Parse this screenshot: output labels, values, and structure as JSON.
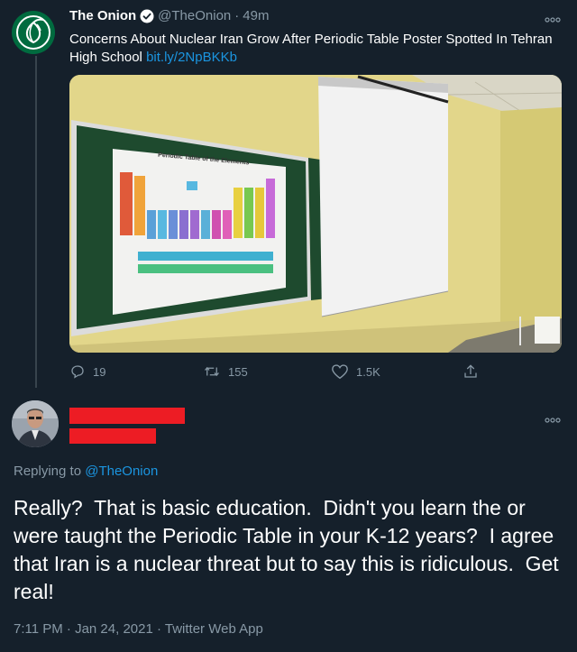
{
  "tweet": {
    "author_name": "The Onion",
    "verified": true,
    "handle": "@TheOnion",
    "separator": "·",
    "time": "49m",
    "text": "Concerns About Nuclear Iran Grow After Periodic Table Poster Spotted In Tehran High School",
    "link": "bit.ly/2NpBKKb",
    "media": {
      "poster_title": "Periodic Table of the Elements"
    },
    "actions": {
      "replies": "19",
      "retweets": "155",
      "likes": "1.5K"
    }
  },
  "reply": {
    "replying_prefix": "Replying to",
    "replying_handle": "@TheOnion",
    "text": "Really?  That is basic education.  Didn't you learn the or were taught the Periodic Table in your K-12 years?  I agree that Iran is a nuclear threat but to say this is ridiculous.  Get real!",
    "timestamp": "7:11 PM · Jan 24, 2021 · Twitter Web App"
  },
  "icons": {
    "more": "more-options-icon",
    "reply": "reply-icon",
    "retweet": "retweet-icon",
    "like": "like-icon",
    "share": "share-icon",
    "verified": "verified-badge-icon",
    "onion_logo": "onion-logo-icon"
  },
  "colors": {
    "background": "#15202b",
    "secondary_text": "#8899a6",
    "link": "#1b95e0",
    "redaction": "#ed1c24",
    "onion_green": "#006b3f"
  }
}
